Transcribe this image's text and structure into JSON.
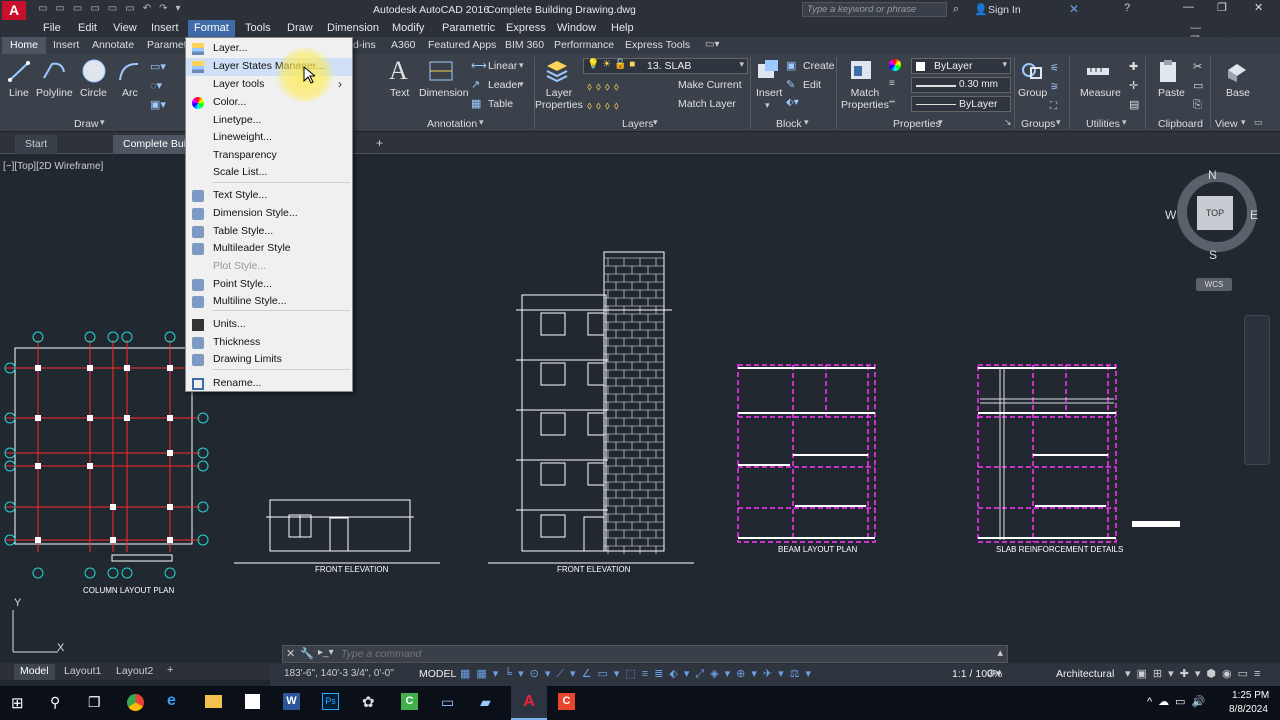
{
  "app": {
    "title": "Autodesk AutoCAD 2016",
    "document": "Complete Building Drawing.dwg",
    "search_placeholder": "Type a keyword or phrase",
    "sign_in": "Sign In"
  },
  "menubar": [
    "File",
    "Edit",
    "View",
    "Insert",
    "Format",
    "Tools",
    "Draw",
    "Dimension",
    "Modify",
    "Parametric",
    "Window",
    "Help",
    "Express"
  ],
  "menubar_labels": {
    "file": "File",
    "edit": "Edit",
    "view": "View",
    "insert": "Insert",
    "format": "Format",
    "tools": "Tools",
    "draw": "Draw",
    "dimension": "Dimension",
    "modify": "Modify",
    "parametric": "Parametric",
    "express": "Express",
    "window": "Window",
    "help": "Help"
  },
  "ribbon_tabs": {
    "home": "Home",
    "insert": "Insert",
    "annotate": "Annotate",
    "parametric": "Parametri",
    "addins": "d-ins",
    "a360": "A360",
    "featured": "Featured Apps",
    "bim360": "BIM 360",
    "performance": "Performance",
    "express": "Express Tools"
  },
  "ribbon": {
    "draw_tools": {
      "line": "Line",
      "polyline": "Polyline",
      "circle": "Circle",
      "arc": "Arc"
    },
    "annotation_tools": {
      "text": "Text",
      "dimension": "Dimension",
      "linear": "Linear",
      "leader": "Leader",
      "table": "Table"
    },
    "layer_tools": {
      "layer_properties": "Layer\nProperties",
      "current_layer": "13. SLAB",
      "make_current": "Make Current",
      "match_layer": "Match Layer"
    },
    "block_tools": {
      "insert": "Insert",
      "create": "Create",
      "edit": "Edit"
    },
    "properties": {
      "match": "Match\nProperties",
      "color": "ByLayer",
      "lineweight": "0.30 mm",
      "linetype": "ByLayer"
    },
    "groups": {
      "group": "Group"
    },
    "utilities": {
      "measure": "Measure"
    },
    "clipboard": {
      "paste": "Paste"
    },
    "view": {
      "base": "Base"
    },
    "panels": {
      "draw": "Draw",
      "annotation": "Annotation",
      "layers": "Layers",
      "block": "Block",
      "properties": "Properties",
      "groups": "Groups",
      "utilities": "Utilities",
      "clipboard": "Clipboard",
      "view": "View"
    }
  },
  "doc_tabs": {
    "start": "Start",
    "drawing": "Complete Buil"
  },
  "viewport_label": "[−][Top][2D Wireframe]",
  "format_menu": {
    "items": [
      {
        "label": "Layer...",
        "icon": "layer-icon"
      },
      {
        "label": "Layer States Manager...",
        "icon": "layer-states-icon",
        "highlighted": true
      },
      {
        "label": "Layer tools",
        "submenu": true
      },
      {
        "label": "Color...",
        "icon": "color-wheel-icon"
      },
      {
        "label": "Linetype..."
      },
      {
        "label": "Lineweight..."
      },
      {
        "label": "Transparency"
      },
      {
        "label": "Scale List..."
      },
      {
        "label": "Text Style...",
        "icon": "text-style-icon"
      },
      {
        "label": "Dimension Style...",
        "icon": "dimension-style-icon"
      },
      {
        "label": "Table Style...",
        "icon": "table-style-icon"
      },
      {
        "label": "Multileader Style",
        "icon": "multileader-style-icon"
      },
      {
        "label": "Plot Style...",
        "disabled": true
      },
      {
        "label": "Point Style...",
        "icon": "point-style-icon"
      },
      {
        "label": "Multiline Style...",
        "icon": "multiline-style-icon"
      },
      {
        "label": "Units...",
        "icon": "units-icon"
      },
      {
        "label": "Thickness",
        "icon": "thickness-icon"
      },
      {
        "label": "Drawing Limits",
        "icon": "drawing-limits-icon"
      },
      {
        "label": "Rename...",
        "icon": "rename-icon"
      }
    ]
  },
  "drawings": {
    "column_plan": "COLUMN LAYOUT PLAN",
    "front_elev_1": "FRONT ELEVATION",
    "front_elev_2": "FRONT ELEVATION",
    "beam_plan": "BEAM LAYOUT PLAN",
    "slab_details": "SLAB REINFORCEMENT DETAILS"
  },
  "viewcube": {
    "n": "N",
    "s": "S",
    "e": "E",
    "w": "W",
    "top": "TOP",
    "wcs": "WCS"
  },
  "command": {
    "placeholder": "Type a command"
  },
  "layout_tabs": {
    "model": "Model",
    "layout1": "Layout1",
    "layout2": "Layout2"
  },
  "status": {
    "coords": "183'-6\", 140'-3 3/4\", 0'-0\"",
    "model": "MODEL",
    "scale": "1:1 / 100%",
    "units": "Architectural"
  },
  "clock": {
    "time": "1:25 PM",
    "date": "8/8/2024"
  },
  "colors": {
    "accent": "#3f6ba8",
    "drawing_red": "#ff2a2a",
    "drawing_magenta": "#ff33ff",
    "drawing_cyan": "#22d6d6",
    "drawing_white": "#ffffff"
  }
}
